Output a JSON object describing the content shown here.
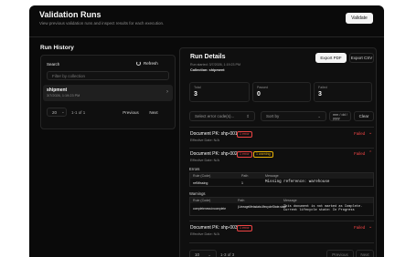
{
  "header": {
    "title": "Validation Runs",
    "subtitle": "View previous validation runs and inspect results for each execution.",
    "validate_label": "Validate"
  },
  "run_history": {
    "title": "Run History",
    "search_label": "Search",
    "refresh_label": "Refresh",
    "filter_placeholder": "Filter by collection",
    "item": {
      "name": "shipment",
      "time": "3/7/2026, 1:19:23 PM"
    },
    "pager": {
      "page_size": "20",
      "range": "1-1 of 1",
      "previous": "Previous",
      "next": "Next"
    }
  },
  "details": {
    "title": "Run Details",
    "run_started": "Run started: 3/7/2026, 1:19:23 PM",
    "collection": "Collection: shipment",
    "export_pdf": "Export PDF",
    "export_csv": "Export CSV",
    "stats": [
      {
        "label": "Total",
        "value": "3"
      },
      {
        "label": "Passed",
        "value": "0"
      },
      {
        "label": "Failed",
        "value": "3"
      }
    ],
    "filters": {
      "error_codes": "Select error code(s)...",
      "sort": "Sort by",
      "date": "mm / dd / yyyy",
      "clear": "Clear"
    },
    "docs": [
      {
        "title": "Document PK: shp-001",
        "badge": "1 error",
        "date": "Effective Date: N/A",
        "status": "Failed"
      },
      {
        "title": "Document PK: shp-002",
        "badge": "1 error",
        "badge2": "1 warning",
        "date": "Effective Date: N/A",
        "status": "Failed",
        "errors_label": "Errors",
        "errors_headers": [
          "Rule (Code)",
          "Path",
          "Message"
        ],
        "errors_row": [
          "refMissing",
          "1",
          "Missing reference: warehouse"
        ],
        "warnings_label": "Warnings",
        "warnings_headers": [
          "Rule (Code)",
          "Path",
          "Message"
        ],
        "warnings_row": [
          "completeness:incomplete",
          "(LineageMetadata.lifecycleState.state",
          "This document is not marked as Complete. Current lifecycle state: In Progress"
        ]
      },
      {
        "title": "Document PK: shp-003",
        "badge": "1 error",
        "date": "Effective Date: N/A",
        "status": "Failed"
      }
    ],
    "pager": {
      "page_size": "10",
      "range": "1-3 of 3",
      "previous": "Previous",
      "next": "Next"
    }
  }
}
